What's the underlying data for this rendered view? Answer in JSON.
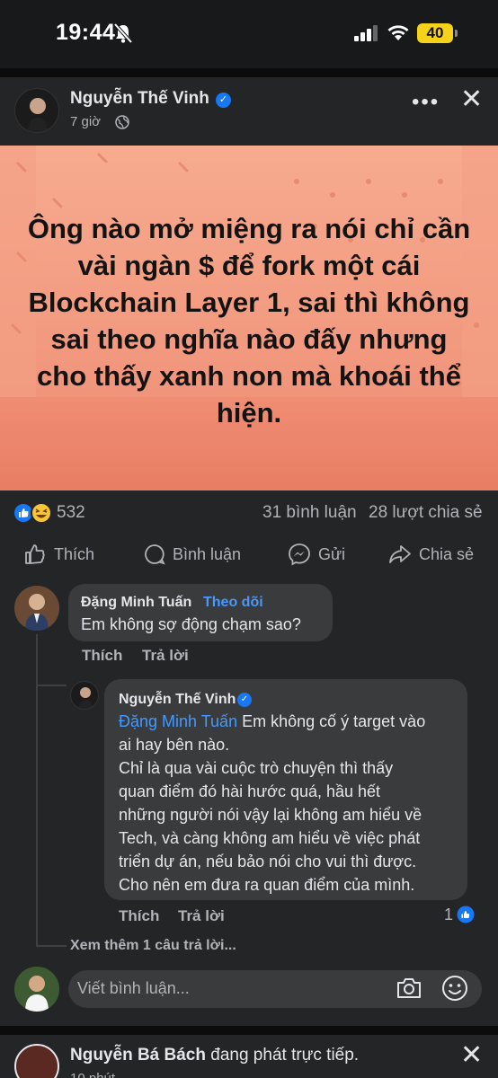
{
  "status": {
    "time": "19:44",
    "battery": "40"
  },
  "post": {
    "author": "Nguyễn Thế Vinh",
    "time": "7 giờ",
    "image_text": "Ông nào mở miệng ra nói chỉ cần vài ngàn $ để fork một cái Blockchain Layer 1, sai thì không sai theo nghĩa nào đấy nhưng cho thấy xanh non mà khoái thể hiện.",
    "reaction_count": "532",
    "comment_count": "31 bình luận",
    "share_count": "28 lượt chia sẻ",
    "actions": {
      "like": "Thích",
      "comment": "Bình luận",
      "send": "Gửi",
      "share": "Chia sẻ"
    }
  },
  "comments": [
    {
      "author": "Đặng Minh Tuấn",
      "follow": "Theo dõi",
      "text": "Em không sợ động chạm sao?",
      "like": "Thích",
      "reply": "Trả lời"
    }
  ],
  "reply": {
    "author": "Nguyễn Thế Vinh",
    "mention": "Đặng Minh Tuấn",
    "line1_rest": " Em không cố ý target vào",
    "lines": [
      "ai hay bên nào.",
      "Chỉ là qua vài cuộc trò chuyện thì thấy",
      "quan điểm đó hài hước quá, hầu hết",
      "những người nói vậy lại không am hiểu về",
      "Tech, và càng không am hiểu về việc phát",
      "triển dự án, nếu bảo nói cho vui thì được.",
      "Cho nên em đưa ra quan điểm của mình."
    ],
    "like": "Thích",
    "reply": "Trả lời",
    "like_count": "1"
  },
  "see_more": "Xem thêm 1 câu trả lời...",
  "comment_input": {
    "placeholder": "Viết bình luận..."
  },
  "next_post": {
    "author": "Nguyễn Bá Bách",
    "rest": " đang phát trực tiếp.",
    "sub": "10 phút"
  },
  "colors": {
    "accent": "#4599ff",
    "fb_blue": "#1877f2",
    "background": "#242526",
    "bubble": "#3a3b3c",
    "image_bg": "#f29a80"
  }
}
